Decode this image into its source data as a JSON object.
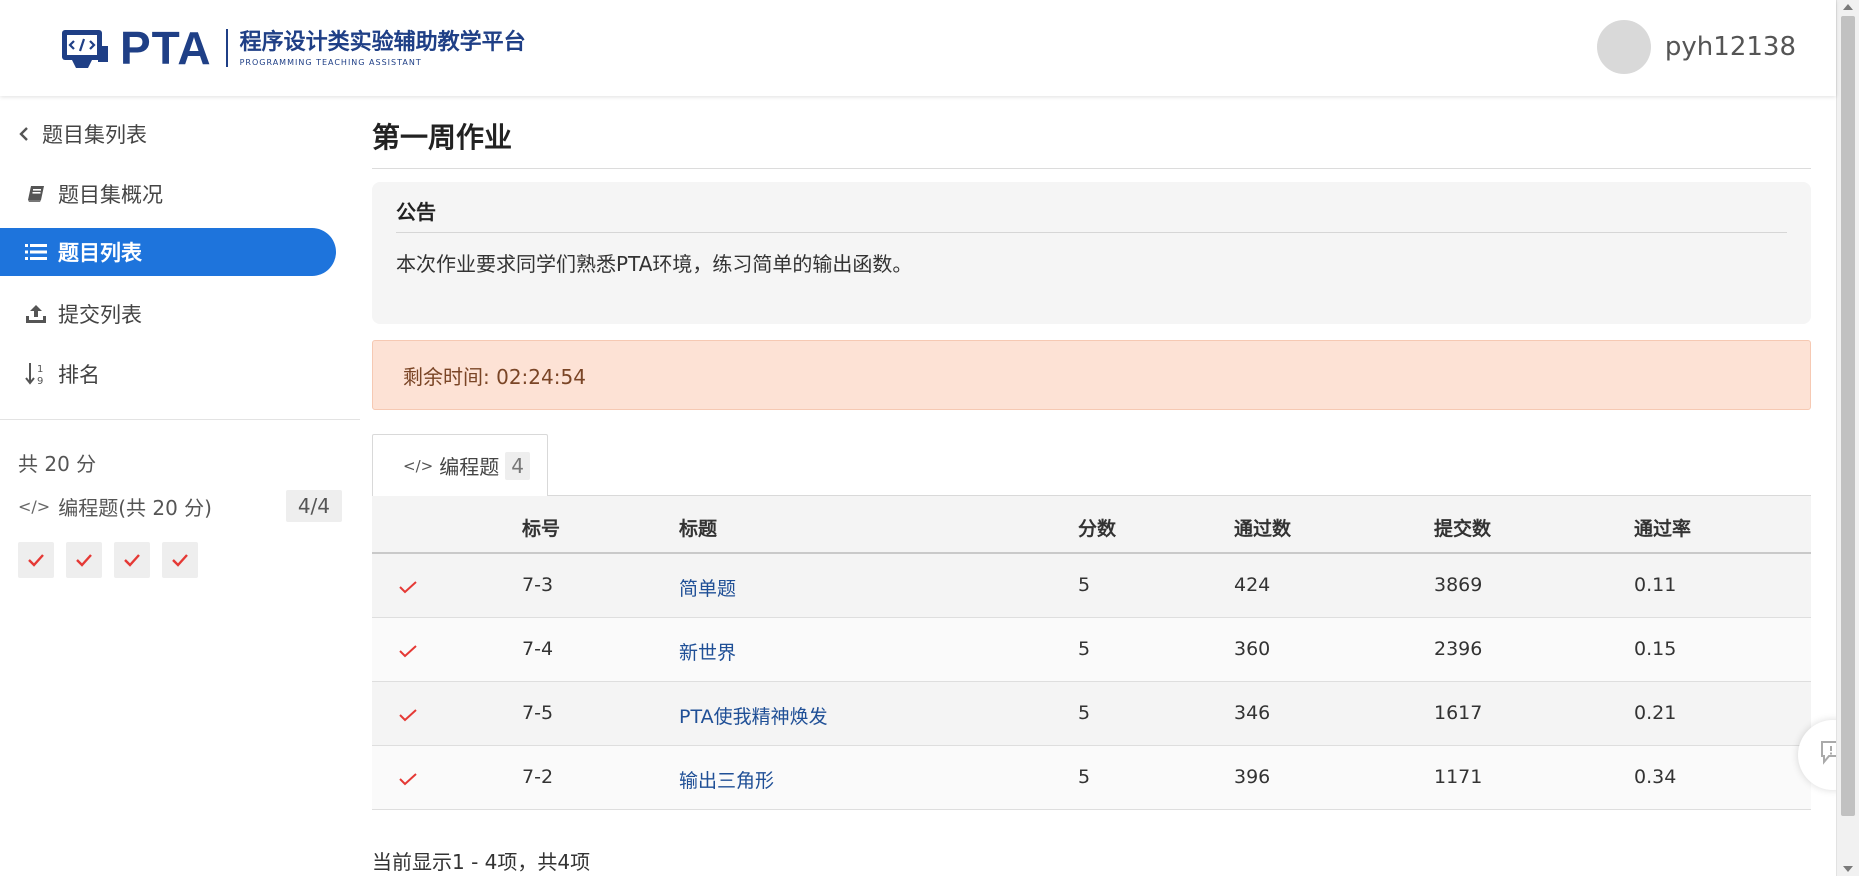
{
  "header": {
    "logo": {
      "brand": "PTA",
      "cn_title": "程序设计类实验辅助教学平台",
      "en_subtitle": "PROGRAMMING TEACHING ASSISTANT"
    },
    "user": {
      "name": "pyh12138"
    }
  },
  "sidebar": {
    "back_label": "题目集列表",
    "items": [
      {
        "label": "题目集概况",
        "icon": "book-icon",
        "active": false
      },
      {
        "label": "题目列表",
        "icon": "list-icon",
        "active": true
      },
      {
        "label": "提交列表",
        "icon": "upload-icon",
        "active": false
      },
      {
        "label": "排名",
        "icon": "sort-numeric-icon",
        "active": false
      }
    ],
    "total_score": "共 20 分",
    "type_label": "编程题(共 20 分)",
    "type_count": "4/4"
  },
  "main": {
    "title": "第一周作业",
    "notice": {
      "title": "公告",
      "body": "本次作业要求同学们熟悉PTA环境，练习简单的输出函数。"
    },
    "timer_text": "剩余时间: 02:24:54",
    "tab": {
      "label": "编程题",
      "count": "4"
    },
    "table": {
      "headers": [
        "标号",
        "标题",
        "分数",
        "通过数",
        "提交数",
        "通过率"
      ],
      "rows": [
        {
          "id": "7-3",
          "title": "简单题",
          "score": "5",
          "passed": "424",
          "submitted": "3869",
          "rate": "0.11"
        },
        {
          "id": "7-4",
          "title": "新世界",
          "score": "5",
          "passed": "360",
          "submitted": "2396",
          "rate": "0.15"
        },
        {
          "id": "7-5",
          "title": "PTA使我精神焕发",
          "score": "5",
          "passed": "346",
          "submitted": "1617",
          "rate": "0.21"
        },
        {
          "id": "7-2",
          "title": "输出三角形",
          "score": "5",
          "passed": "396",
          "submitted": "1171",
          "rate": "0.34"
        }
      ]
    },
    "pager_text": "当前显示1 - 4项，共4项"
  },
  "colors": {
    "brand": "#1f3f86",
    "accent": "#1e74dc",
    "success_check": "#e53935",
    "link": "#1f4f96",
    "timer_bg": "#fde2d5"
  }
}
